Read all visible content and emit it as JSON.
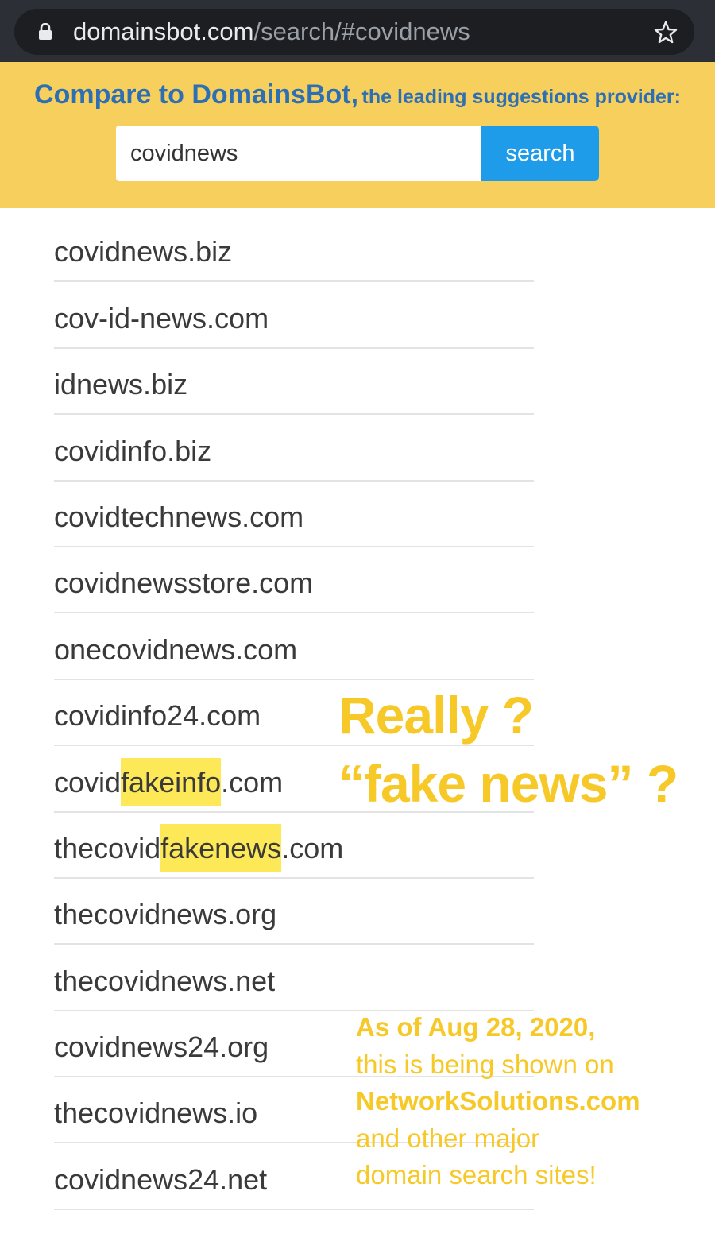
{
  "browser": {
    "url_host": "domainsbot.com",
    "url_path": "/search/#covidnews",
    "icons": [
      "lock-icon",
      "star-icon"
    ]
  },
  "banner": {
    "title": "Compare to DomainsBot,",
    "subtitle": "the leading suggestions provider:",
    "search_value": "covidnews",
    "search_button": "search",
    "colors": {
      "banner_bg": "#f6cf5c",
      "title": "#2d6fb5",
      "button": "#1e9be9"
    }
  },
  "results": [
    {
      "pre": "covidnews.biz",
      "hl": "",
      "post": ""
    },
    {
      "pre": "cov-id-news.com",
      "hl": "",
      "post": ""
    },
    {
      "pre": "idnews.biz",
      "hl": "",
      "post": ""
    },
    {
      "pre": "covidinfo.biz",
      "hl": "",
      "post": ""
    },
    {
      "pre": "covidtechnews.com",
      "hl": "",
      "post": ""
    },
    {
      "pre": "covidnewsstore.com",
      "hl": "",
      "post": ""
    },
    {
      "pre": "onecovidnews.com",
      "hl": "",
      "post": ""
    },
    {
      "pre": "covidinfo24.com",
      "hl": "",
      "post": ""
    },
    {
      "pre": "covid",
      "hl": "fakeinfo",
      "post": ".com"
    },
    {
      "pre": "thecovid",
      "hl": "fakenews",
      "post": ".com"
    },
    {
      "pre": "thecovidnews.org",
      "hl": "",
      "post": ""
    },
    {
      "pre": "thecovidnews.net",
      "hl": "",
      "post": ""
    },
    {
      "pre": "covidnews24.org",
      "hl": "",
      "post": ""
    },
    {
      "pre": "thecovidnews.io",
      "hl": "",
      "post": ""
    },
    {
      "pre": "covidnews24.net",
      "hl": "",
      "post": ""
    }
  ],
  "annotation": {
    "line1": "Really ?",
    "line2": "“fake news” ?",
    "note_line1": "As of Aug 28, 2020,",
    "note_line2": "this is being shown on",
    "note_line3": "NetworkSolutions.com",
    "note_line4": "and other major",
    "note_line5": "domain search sites!",
    "color": "#f7c928",
    "highlight_color": "#fde957"
  }
}
